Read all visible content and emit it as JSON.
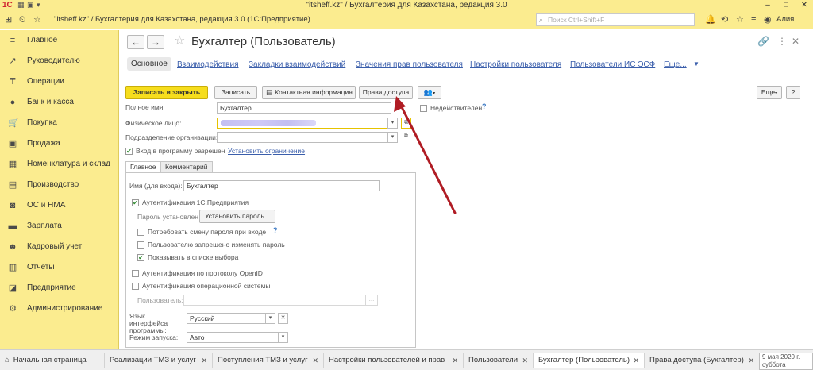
{
  "window": {
    "title": "\"itsheff.kz\" / Бухгалтерия для Казахстана, редакция 3.0",
    "logo": "1С",
    "controls": {
      "minimize": "–",
      "maximize": "□",
      "close": "✕"
    }
  },
  "toolbar": {
    "breadcrumb": "\"itsheff.kz\" / Бухгалтерия для Казахстана, редакция 3.0  (1С:Предприятие)",
    "search_placeholder": "Поиск Ctrl+Shift+F",
    "user": "Алия"
  },
  "sidebar": {
    "items": [
      {
        "label": "Главное",
        "icon": "menu-icon",
        "glyph": "≡"
      },
      {
        "label": "Руководителю",
        "icon": "trend-icon",
        "glyph": "↗"
      },
      {
        "label": "Операции",
        "icon": "operations-icon",
        "glyph": "₸"
      },
      {
        "label": "Банк и касса",
        "icon": "bank-icon",
        "glyph": "●"
      },
      {
        "label": "Покупка",
        "icon": "cart-icon",
        "glyph": "🛒"
      },
      {
        "label": "Продажа",
        "icon": "sale-icon",
        "glyph": "▣"
      },
      {
        "label": "Номенклатура и склад",
        "icon": "warehouse-icon",
        "glyph": "▦"
      },
      {
        "label": "Производство",
        "icon": "factory-icon",
        "glyph": "▤"
      },
      {
        "label": "ОС и НМА",
        "icon": "assets-icon",
        "glyph": "◙"
      },
      {
        "label": "Зарплата",
        "icon": "salary-icon",
        "glyph": "▬"
      },
      {
        "label": "Кадровый учет",
        "icon": "people-icon",
        "glyph": "☻"
      },
      {
        "label": "Отчеты",
        "icon": "reports-icon",
        "glyph": "▥"
      },
      {
        "label": "Предприятие",
        "icon": "enterprise-icon",
        "glyph": "◪"
      },
      {
        "label": "Администрирование",
        "icon": "gear-icon",
        "glyph": "⚙"
      }
    ]
  },
  "form": {
    "title": "Бухгалтер (Пользователь)",
    "nav_back": "←",
    "nav_forward": "→",
    "tabs": [
      {
        "label": "Основное"
      },
      {
        "label": "Взаимодействия"
      },
      {
        "label": "Закладки взаимодействий"
      },
      {
        "label": "Значения прав пользователя"
      },
      {
        "label": "Настройки пользователя"
      },
      {
        "label": "Пользователи ИС ЭСФ"
      },
      {
        "label": "Еще..."
      }
    ],
    "buttons": {
      "save_close": "Записать и закрыть",
      "save": "Записать",
      "contact": "Контактная информация",
      "access": "Права доступа",
      "more": "Еще",
      "help": "?"
    },
    "fields": {
      "full_name_label": "Полное имя:",
      "full_name_value": "Бухгалтер",
      "invalid_label": "Недействителен",
      "person_label": "Физическое лицо:",
      "department_label": "Подразделение организации:",
      "login_allowed_label": "Вход в программу разрешен",
      "set_restriction": "Установить ограничение"
    },
    "subtabs": [
      "Главное",
      "Комментарий"
    ],
    "main_tab": {
      "login_name_label": "Имя (для входа):",
      "login_name_value": "Бухгалтер",
      "auth_1c": "Аутентификация 1С:Предприятия",
      "password_set": "Пароль установлен",
      "set_password": "Установить пароль...",
      "require_change": "Потребовать смену пароля при входе",
      "forbid_change": "Пользователю запрещено изменять пароль",
      "show_in_list": "Показывать в списке выбора",
      "auth_openid": "Аутентификация по протоколу OpenID",
      "auth_os": "Аутентификация операционной системы",
      "os_user_label": "Пользователь:",
      "lang_label": "Язык интерфейса программы:",
      "lang_value": "Русский",
      "mode_label": "Режим запуска:",
      "mode_value": "Авто"
    }
  },
  "taskbar": {
    "tabs": [
      {
        "label": "Начальная страница"
      },
      {
        "label": "Реализации ТМЗ и услуг"
      },
      {
        "label": "Поступления ТМЗ и услуг"
      },
      {
        "label": "Настройки пользователей и прав"
      },
      {
        "label": "Пользователи"
      },
      {
        "label": "Бухгалтер (Пользователь)"
      },
      {
        "label": "Права доступа (Бухгалтер)"
      }
    ],
    "date": "9 мая 2020 г.",
    "weekday": "суббота"
  },
  "colors": {
    "accent_yellow": "#fbec8f",
    "primary_button": "#f6dd1d",
    "link_blue": "#3a5eab",
    "annotation_arrow": "#b01c24"
  }
}
